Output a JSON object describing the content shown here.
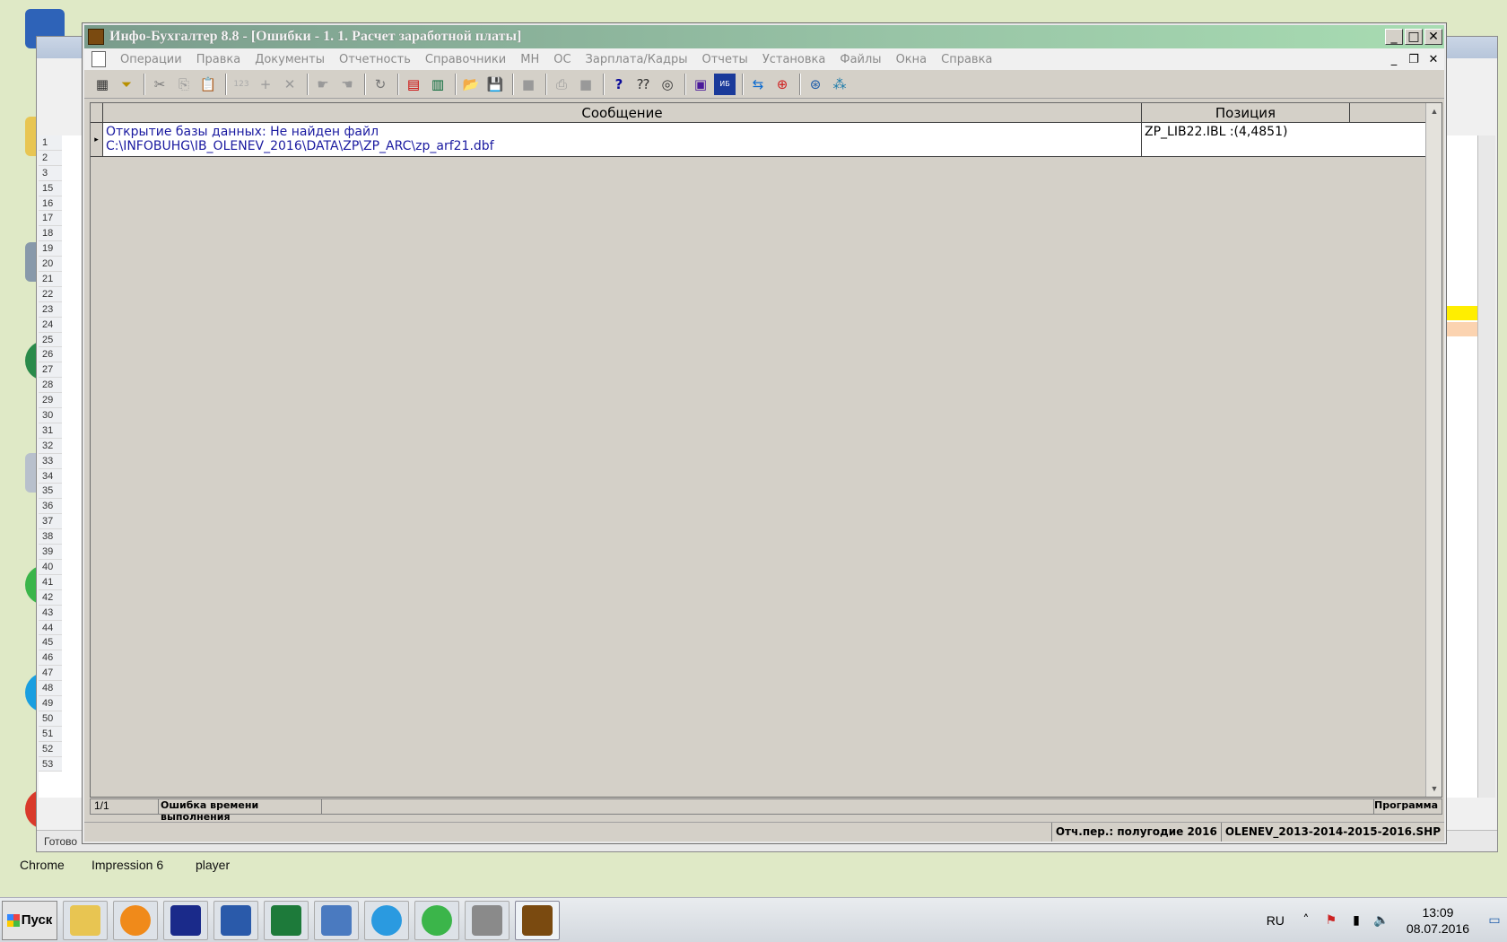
{
  "window": {
    "title": "Инфо-Бухгалтер 8.8 - [Ошибки - 1. 1. Расчет заработной платы]",
    "minimize": "_",
    "maximize": "□",
    "close": "✕"
  },
  "menu": [
    "Операции",
    "Правка",
    "Документы",
    "Отчетность",
    "Справочники",
    "МН",
    "ОС",
    "Зарплата/Кадры",
    "Отчеты",
    "Установка",
    "Файлы",
    "Окна",
    "Справка"
  ],
  "grid": {
    "columns": [
      "Сообщение",
      "Позиция"
    ],
    "rows": [
      {
        "message_line1": "Открытие базы данных: Не найден файл",
        "message_line2": "C:\\INFOBUHG\\IB_OLENEV_2016\\DATA\\ZP\\ZP_ARC\\zp_arf21.dbf",
        "position": "ZP_LIB22.IBL :(4,4851)"
      }
    ]
  },
  "grid_status": {
    "count": "1/1",
    "message": "Ошибка времени выполнения",
    "program": "Программа"
  },
  "app_status": {
    "period": "Отч.пер.: полугодие 2016",
    "file": "OLENEV_2013-2014-2015-2016.SHP"
  },
  "excel": {
    "ready": "Готово",
    "rows": [
      "1",
      "2",
      "3",
      "15",
      "16",
      "17",
      "18",
      "19",
      "20",
      "21",
      "22",
      "23",
      "24",
      "25",
      "26",
      "27",
      "28",
      "29",
      "30",
      "31",
      "32",
      "33",
      "34",
      "35",
      "36",
      "37",
      "38",
      "39",
      "40",
      "41",
      "42",
      "43",
      "44",
      "45",
      "46",
      "47",
      "48",
      "49",
      "50",
      "51",
      "52",
      "53"
    ]
  },
  "desktop": {
    "labels": [
      "Chrome",
      "Impression 6",
      "player"
    ]
  },
  "taskbar": {
    "start": "Пуск",
    "lang": "RU",
    "time": "13:09",
    "date": "08.07.2016"
  }
}
